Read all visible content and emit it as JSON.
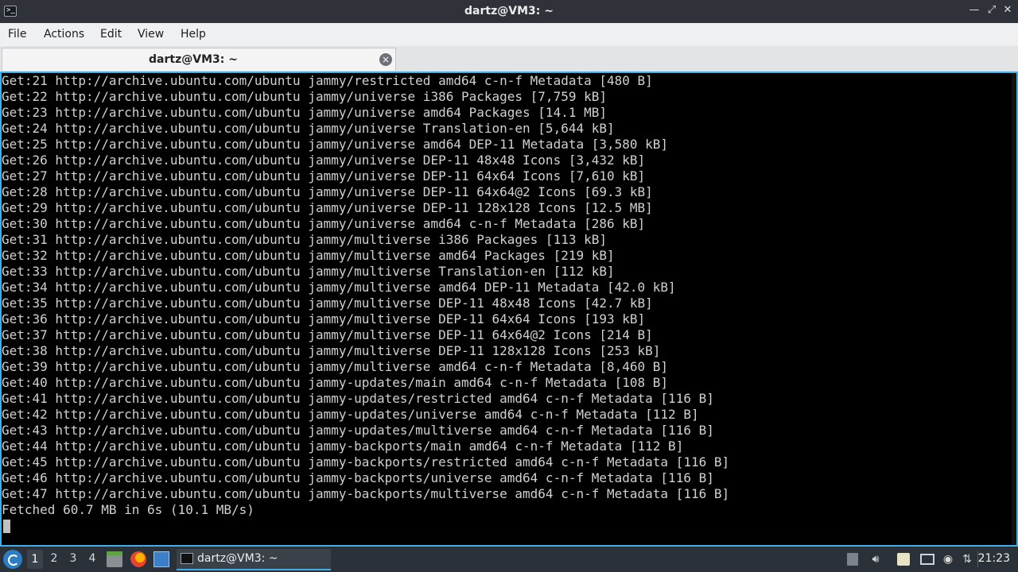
{
  "window": {
    "title": "dartz@VM3: ~",
    "app_icon_glyph": ">_"
  },
  "menu": {
    "file": "File",
    "actions": "Actions",
    "edit": "Edit",
    "view": "View",
    "help": "Help"
  },
  "tab": {
    "title": "dartz@VM3: ~",
    "close_glyph": "×"
  },
  "terminal": {
    "lines": [
      "Get:21 http://archive.ubuntu.com/ubuntu jammy/restricted amd64 c-n-f Metadata [480 B]",
      "Get:22 http://archive.ubuntu.com/ubuntu jammy/universe i386 Packages [7,759 kB]",
      "Get:23 http://archive.ubuntu.com/ubuntu jammy/universe amd64 Packages [14.1 MB]",
      "Get:24 http://archive.ubuntu.com/ubuntu jammy/universe Translation-en [5,644 kB]",
      "Get:25 http://archive.ubuntu.com/ubuntu jammy/universe amd64 DEP-11 Metadata [3,580 kB]",
      "Get:26 http://archive.ubuntu.com/ubuntu jammy/universe DEP-11 48x48 Icons [3,432 kB]",
      "Get:27 http://archive.ubuntu.com/ubuntu jammy/universe DEP-11 64x64 Icons [7,610 kB]",
      "Get:28 http://archive.ubuntu.com/ubuntu jammy/universe DEP-11 64x64@2 Icons [69.3 kB]",
      "Get:29 http://archive.ubuntu.com/ubuntu jammy/universe DEP-11 128x128 Icons [12.5 MB]",
      "Get:30 http://archive.ubuntu.com/ubuntu jammy/universe amd64 c-n-f Metadata [286 kB]",
      "Get:31 http://archive.ubuntu.com/ubuntu jammy/multiverse i386 Packages [113 kB]",
      "Get:32 http://archive.ubuntu.com/ubuntu jammy/multiverse amd64 Packages [219 kB]",
      "Get:33 http://archive.ubuntu.com/ubuntu jammy/multiverse Translation-en [112 kB]",
      "Get:34 http://archive.ubuntu.com/ubuntu jammy/multiverse amd64 DEP-11 Metadata [42.0 kB]",
      "Get:35 http://archive.ubuntu.com/ubuntu jammy/multiverse DEP-11 48x48 Icons [42.7 kB]",
      "Get:36 http://archive.ubuntu.com/ubuntu jammy/multiverse DEP-11 64x64 Icons [193 kB]",
      "Get:37 http://archive.ubuntu.com/ubuntu jammy/multiverse DEP-11 64x64@2 Icons [214 B]",
      "Get:38 http://archive.ubuntu.com/ubuntu jammy/multiverse DEP-11 128x128 Icons [253 kB]",
      "Get:39 http://archive.ubuntu.com/ubuntu jammy/multiverse amd64 c-n-f Metadata [8,460 B]",
      "Get:40 http://archive.ubuntu.com/ubuntu jammy-updates/main amd64 c-n-f Metadata [108 B]",
      "Get:41 http://archive.ubuntu.com/ubuntu jammy-updates/restricted amd64 c-n-f Metadata [116 B]",
      "Get:42 http://archive.ubuntu.com/ubuntu jammy-updates/universe amd64 c-n-f Metadata [112 B]",
      "Get:43 http://archive.ubuntu.com/ubuntu jammy-updates/multiverse amd64 c-n-f Metadata [116 B]",
      "Get:44 http://archive.ubuntu.com/ubuntu jammy-backports/main amd64 c-n-f Metadata [112 B]",
      "Get:45 http://archive.ubuntu.com/ubuntu jammy-backports/restricted amd64 c-n-f Metadata [116 B]",
      "Get:46 http://archive.ubuntu.com/ubuntu jammy-backports/universe amd64 c-n-f Metadata [116 B]",
      "Get:47 http://archive.ubuntu.com/ubuntu jammy-backports/multiverse amd64 c-n-f Metadata [116 B]",
      "Fetched 60.7 MB in 6s (10.1 MB/s)"
    ],
    "accent_color": "#3daee9"
  },
  "taskbar": {
    "workspaces": [
      "1",
      "2",
      "3",
      "4"
    ],
    "active_workspace": "1",
    "task_label": "dartz@VM3: ~",
    "clock": "21:23",
    "icons": {
      "start": "start-menu-icon",
      "files": "file-manager-icon",
      "browser": "firefox-icon",
      "desktop": "show-desktop-icon",
      "clipboard": "clipboard-icon",
      "volume": "volume-icon",
      "keyboard": "keyboard-layout-icon",
      "display": "display-icon",
      "updates": "update-notifier-icon",
      "network": "network-icon"
    }
  }
}
